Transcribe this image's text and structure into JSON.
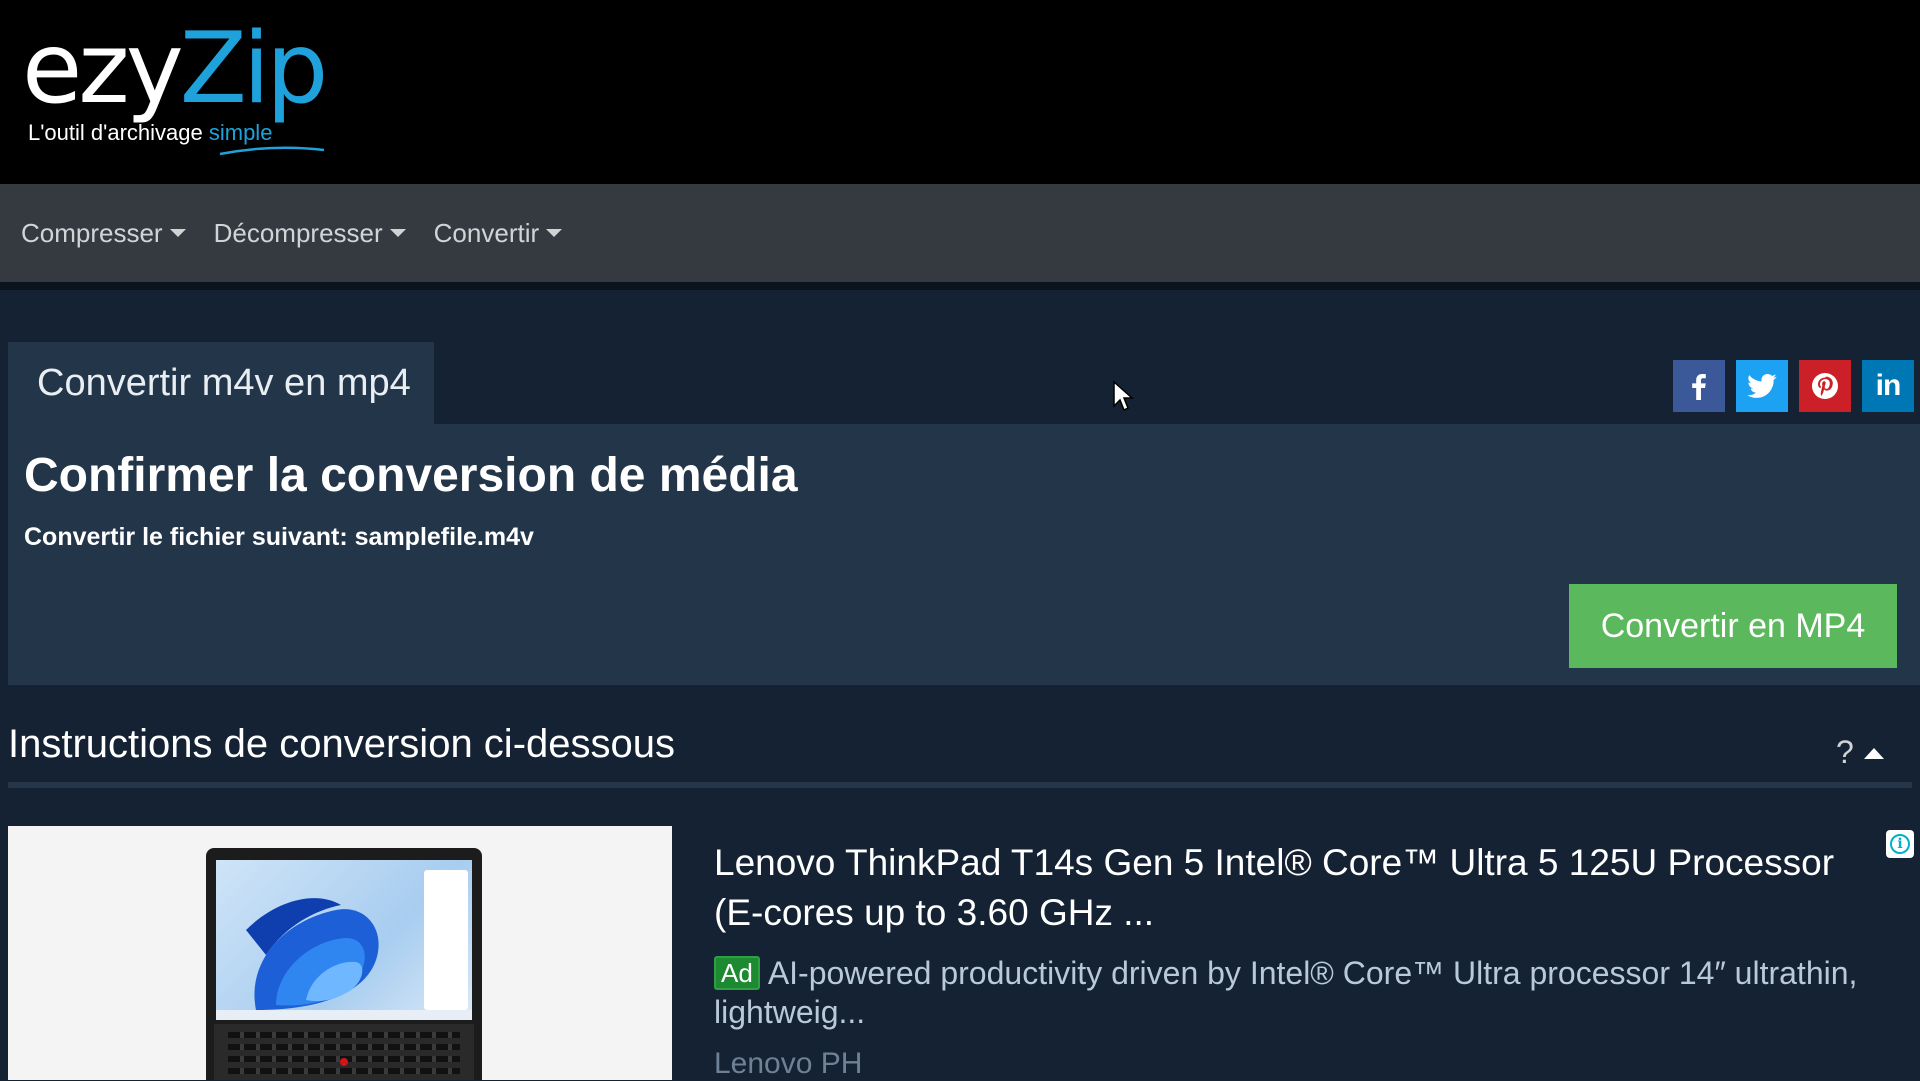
{
  "header": {
    "logo": {
      "part1": "ezy",
      "part2": "Zip",
      "tagline": "L'outil d'archivage ",
      "tagline_accent": "simple"
    }
  },
  "nav": {
    "items": [
      {
        "label": "Compresser"
      },
      {
        "label": "Décompresser"
      },
      {
        "label": "Convertir"
      }
    ]
  },
  "tab": {
    "label": "Convertir m4v en mp4"
  },
  "social": {
    "linkedin_text": "in"
  },
  "card": {
    "title": "Confirmer la conversion de média",
    "file_line": "Convertir le fichier suivant: samplefile.m4v",
    "button_label": "Convertir en MP4"
  },
  "instructions": {
    "title": "Instructions de conversion ci-dessous",
    "help": "?"
  },
  "ad": {
    "title": "Lenovo ThinkPad T14s Gen 5 Intel® Core™ Ultra 5 125U Processor (E-cores up to 3.60 GHz ...",
    "badge": "Ad",
    "description": "AI-powered productivity driven by Intel® Core™ Ultra processor 14″ ultrathin, lightweig...",
    "source": "Lenovo PH",
    "info": "i"
  },
  "colors": {
    "brand_accent": "#1fa2db",
    "primary_bg": "#142233",
    "card_bg": "#233549",
    "nav_bg": "#343a40",
    "success_button": "#5cb85c"
  }
}
